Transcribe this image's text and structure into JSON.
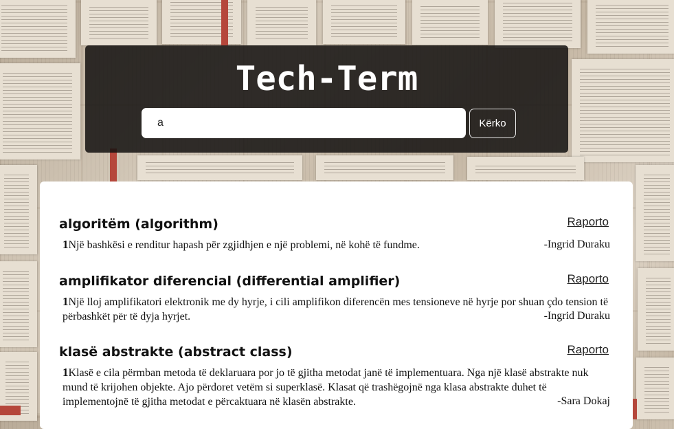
{
  "header": {
    "title": "Tech-Term",
    "search_value": "a",
    "search_button_label": "Kërko"
  },
  "results": [
    {
      "term": "algoritëm (algorithm)",
      "report_label": "Raporto",
      "number": "1",
      "definition": "Një bashkësi e renditur hapash për zgjidhjen e një problemi, në kohë të fundme.",
      "author": "-Ingrid Duraku"
    },
    {
      "term": "amplifikator diferencial (differential amplifier)",
      "report_label": "Raporto",
      "number": "1",
      "definition": "Një lloj amplifikatori elektronik me dy hyrje, i cili amplifikon diferencën mes tensioneve në hyrje por shuan çdo tension të përbashkët për të dyja hyrjet.",
      "author": "-Ingrid Duraku"
    },
    {
      "term": "klasë abstrakte (abstract class)",
      "report_label": "Raporto",
      "number": "1",
      "definition": "Klasë e cila përmban metoda të deklaruara por jo të gjitha metodat janë të implementuara. Nga një klasë abstrakte nuk mund të krijohen objekte. Ajo përdoret vetëm si superklasë. Klasat që trashëgojnë nga klasa abstrakte duhet të implementojnë të gjitha metodat e përcaktuara në klasën abstrakte.",
      "author": "-Sara Dokaj"
    }
  ]
}
